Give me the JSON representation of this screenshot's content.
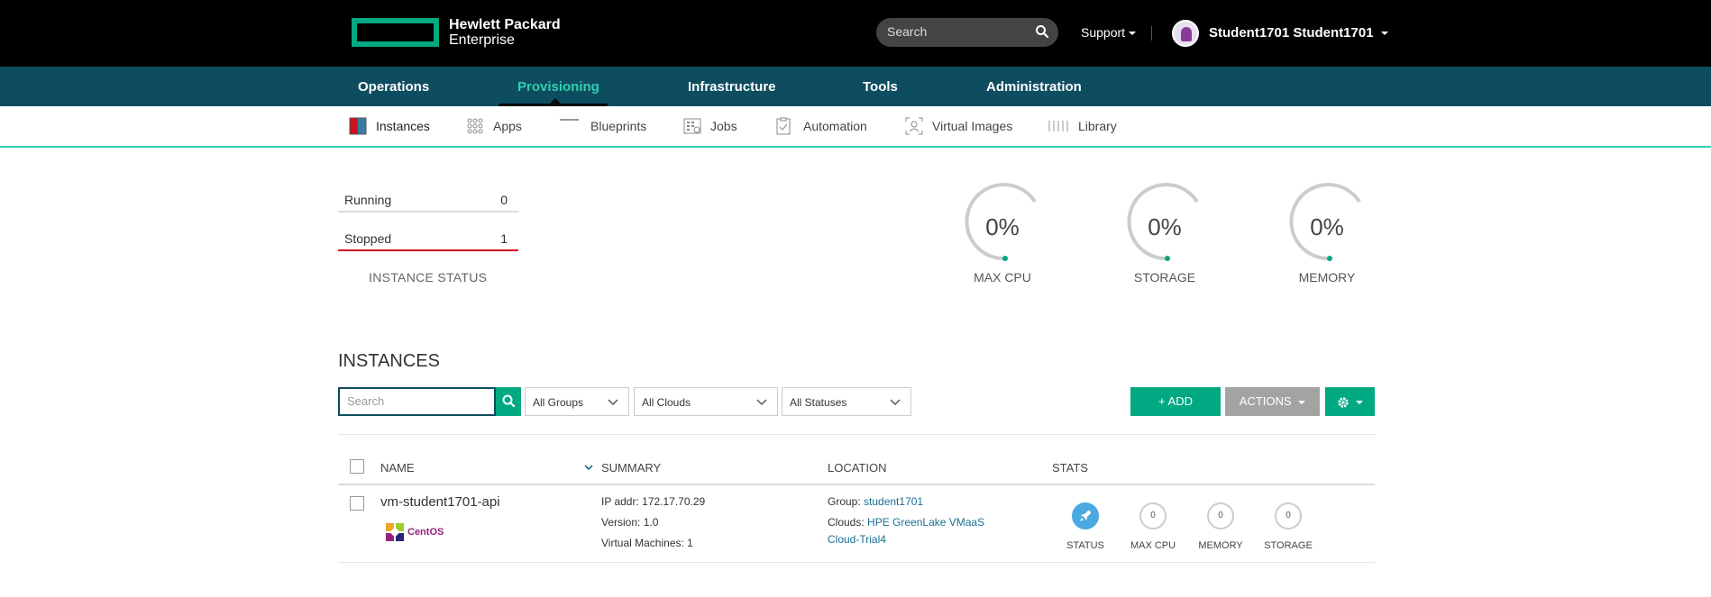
{
  "header": {
    "logo_line1": "Hewlett Packard",
    "logo_line2": "Enterprise",
    "brand_color": "#01a982",
    "search_placeholder": "Search",
    "support_label": "Support",
    "user_name": "Student1701 Student1701"
  },
  "main_nav": {
    "items": [
      "Operations",
      "Provisioning",
      "Infrastructure",
      "Tools",
      "Administration"
    ],
    "active": "Provisioning",
    "background": "#0e4d60",
    "active_color": "#2fcfb2"
  },
  "sub_nav": {
    "items": [
      "Instances",
      "Apps",
      "Blueprints",
      "Jobs",
      "Automation",
      "Virtual Images",
      "Library"
    ],
    "active": "Instances"
  },
  "instance_status": {
    "running_label": "Running",
    "running_value": "0",
    "stopped_label": "Stopped",
    "stopped_value": "1",
    "title": "INSTANCE STATUS"
  },
  "gauges": [
    {
      "value": "0%",
      "label": "MAX CPU"
    },
    {
      "value": "0%",
      "label": "STORAGE"
    },
    {
      "value": "0%",
      "label": "MEMORY"
    }
  ],
  "instances": {
    "title": "INSTANCES",
    "search_placeholder": "Search",
    "filter_groups": "All Groups",
    "filter_clouds": "All Clouds",
    "filter_statuses": "All Statuses",
    "add_label": "+ ADD",
    "actions_label": "ACTIONS",
    "columns": [
      "NAME",
      "SUMMARY",
      "LOCATION",
      "STATS"
    ],
    "row": {
      "name": "vm-student1701-api",
      "os_label": "CentOS",
      "ip": "IP addr: 172.17.70.29",
      "version": "Version: 1.0",
      "vms": "Virtual Machines: 1",
      "group_label": "Group:",
      "group_value": "student1701",
      "clouds_label": "Clouds:",
      "clouds_value_1": "HPE GreenLake VMaaS",
      "clouds_value_2": "Cloud-Trial4",
      "stats": {
        "status_label": "STATUS",
        "max_cpu_value": "0",
        "max_cpu_label": "MAX CPU",
        "memory_value": "0",
        "memory_label": "MEMORY",
        "storage_value": "0",
        "storage_label": "STORAGE"
      }
    }
  }
}
